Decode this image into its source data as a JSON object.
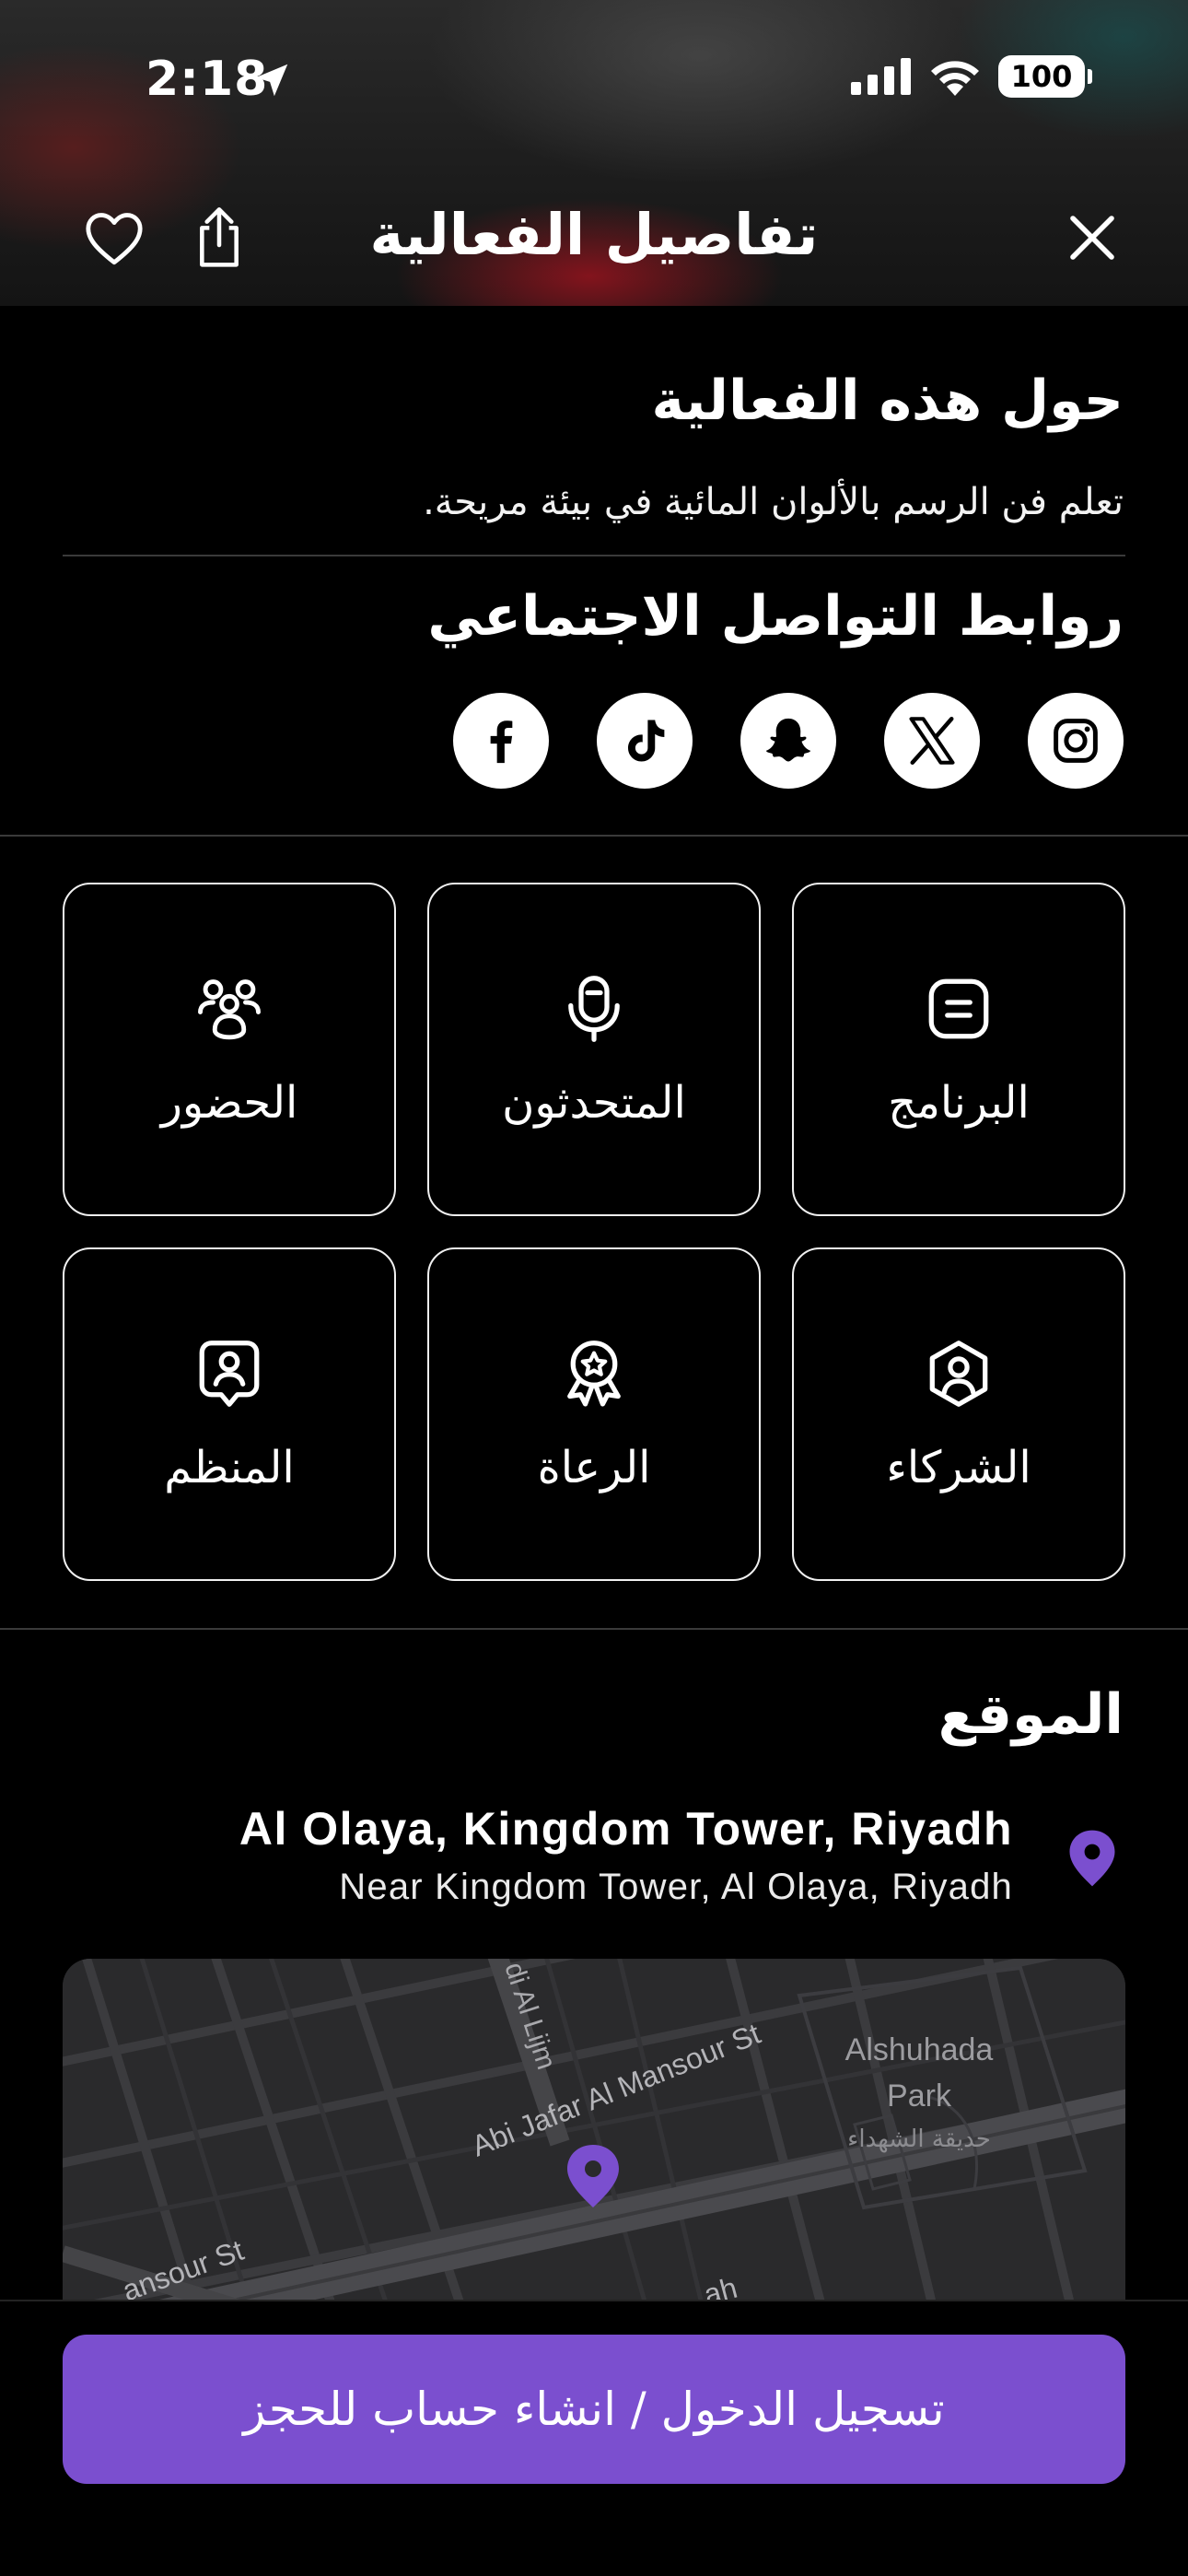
{
  "status_bar": {
    "time": "2:18",
    "battery": "100"
  },
  "header": {
    "title": "تفاصيل الفعالية"
  },
  "about": {
    "heading": "حول هذه الفعالية",
    "description": "تعلم فن الرسم بالألوان المائية في بيئة مريحة."
  },
  "social": {
    "heading": "روابط التواصل الاجتماعي",
    "links": [
      {
        "icon": "instagram-icon"
      },
      {
        "icon": "x-icon"
      },
      {
        "icon": "snapchat-icon"
      },
      {
        "icon": "tiktok-icon"
      },
      {
        "icon": "facebook-icon"
      }
    ]
  },
  "tiles": [
    {
      "label": "البرنامج",
      "icon": "document-icon"
    },
    {
      "label": "المتحدثون",
      "icon": "microphone-icon"
    },
    {
      "label": "الحضور",
      "icon": "people-icon"
    },
    {
      "label": "الشركاء",
      "icon": "partner-icon"
    },
    {
      "label": "الرعاة",
      "icon": "award-icon"
    },
    {
      "label": "المنظم",
      "icon": "organizer-icon"
    }
  ],
  "location": {
    "heading": "الموقع",
    "title": "Al Olaya, Kingdom Tower, Riyadh",
    "subtitle": "Near Kingdom Tower, Al Olaya, Riyadh",
    "pin_color": "#7b4fcf",
    "map_labels": {
      "street_main": "Abi Jafar Al Mansour St",
      "street_side": "di Al Lijm",
      "street_corner": "ansour St",
      "street_bottom": "ah",
      "park_line1": "Alshuhada",
      "park_line2": "Park",
      "park_arabic": "حديقة الشهداء"
    }
  },
  "cta": {
    "label": "تسجيل الدخول / انشاء حساب للحجز",
    "color": "#7b4fcf"
  }
}
